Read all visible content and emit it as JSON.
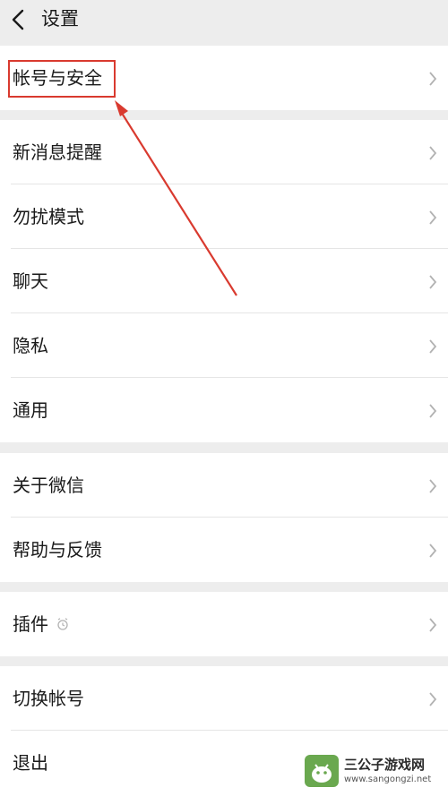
{
  "header": {
    "title": "设置",
    "back_icon": "chevron-left-icon"
  },
  "groups": [
    {
      "items": [
        {
          "label": "帐号与安全"
        }
      ]
    },
    {
      "items": [
        {
          "label": "新消息提醒"
        },
        {
          "label": "勿扰模式"
        },
        {
          "label": "聊天"
        },
        {
          "label": "隐私"
        },
        {
          "label": "通用"
        }
      ]
    },
    {
      "items": [
        {
          "label": "关于微信"
        },
        {
          "label": "帮助与反馈"
        }
      ]
    },
    {
      "items": [
        {
          "label": "插件"
        }
      ]
    },
    {
      "items": [
        {
          "label": "切换帐号"
        },
        {
          "label": "退出"
        }
      ]
    }
  ],
  "icons": {
    "row_chevron": "chevron-right-icon",
    "plugin": "alarm-clock-icon"
  },
  "annotation": {
    "color": "#d93a2f"
  },
  "watermark": {
    "title": "三公子游戏网",
    "url": "www.sangongzi.net"
  },
  "colors": {
    "background": "#ededed",
    "row": "#ffffff",
    "divider": "#e5e5e5",
    "chevron": "#b2b2b2"
  }
}
